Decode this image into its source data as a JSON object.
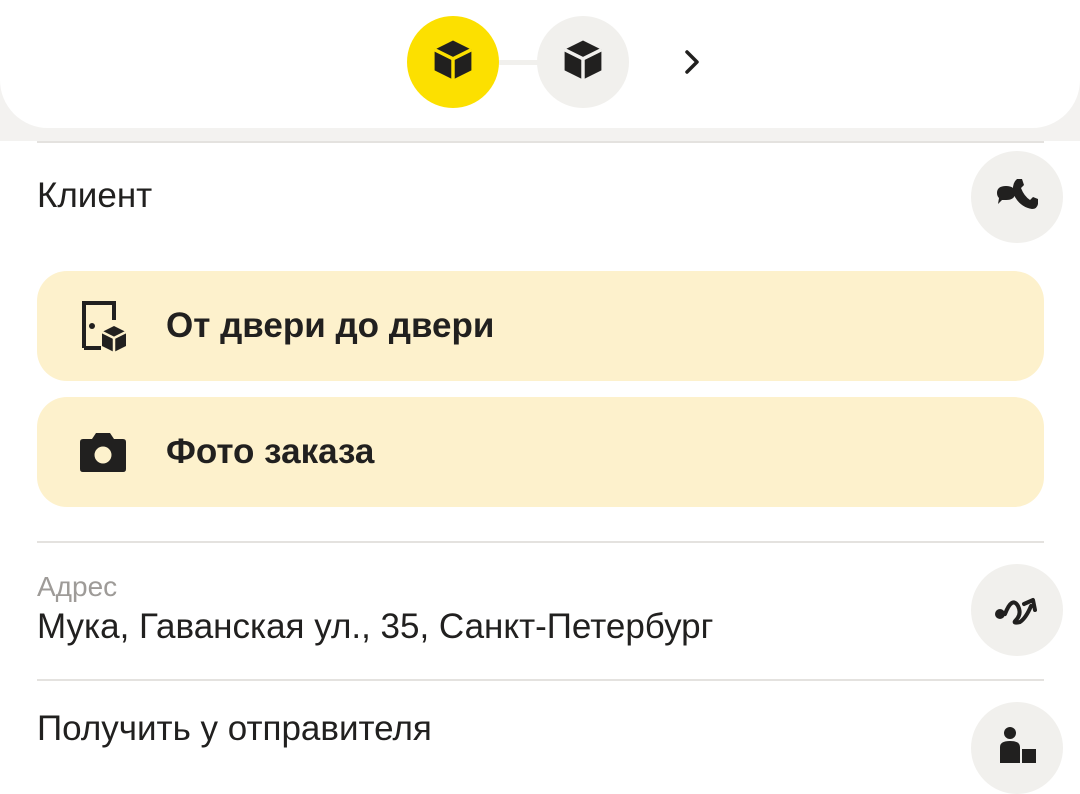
{
  "header": {
    "steps": [
      {
        "icon": "package-icon",
        "active": true
      },
      {
        "icon": "package-icon",
        "active": false
      }
    ],
    "next_icon": "chevron-right-icon"
  },
  "client": {
    "label": "Клиент",
    "action_icon": "chat-phone-icon"
  },
  "options": [
    {
      "icon": "door-package-icon",
      "label": "От двери до двери"
    },
    {
      "icon": "camera-icon",
      "label": "Фото заказа"
    }
  ],
  "address": {
    "caption": "Адрес",
    "value": "Мука, Гаванская ул., 35, Санкт-Петербург",
    "action_icon": "route-icon"
  },
  "pickup": {
    "label": "Получить у отправителя",
    "action_icon": "person-package-icon"
  },
  "colors": {
    "accent_yellow": "#fce000",
    "card_background": "#fdf1cc",
    "button_background": "#f1f0ed",
    "text_primary": "#21201f",
    "text_secondary": "#9e9b98"
  }
}
